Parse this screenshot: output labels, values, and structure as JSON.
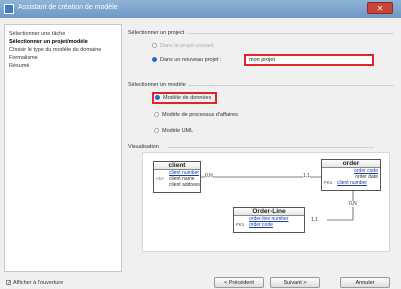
{
  "window": {
    "title": "Assistant de création de modèle"
  },
  "sidebar": {
    "items": [
      {
        "label": "Sélectionner une tâche"
      },
      {
        "label": "Sélectionner un projet/modèle"
      },
      {
        "label": "Choisir le type du modèle du domaine"
      },
      {
        "label": "Formalisme"
      },
      {
        "label": "Résumé"
      }
    ]
  },
  "project": {
    "section_label": "Sélectionner un project",
    "current_label": "Dans le projet courant",
    "new_label": "Dans un nouveau projet :",
    "new_value": "mon projet"
  },
  "model": {
    "section_label": "Sélectionner un modèle",
    "options": [
      {
        "label": "Modèle de données"
      },
      {
        "label": "Modèle de processus d'affaires"
      },
      {
        "label": "Modèle UML"
      }
    ]
  },
  "preview": {
    "label": "Visualisation",
    "client": {
      "name": "client",
      "rows": [
        {
          "key": "",
          "text": "client number"
        },
        {
          "key": "<1>",
          "text": "client name"
        },
        {
          "key": "",
          "text": "client address"
        }
      ]
    },
    "order": {
      "name": "order",
      "rows": [
        {
          "key": "",
          "text": "order code"
        },
        {
          "key": "",
          "text": "order date"
        },
        {
          "key": "FK1",
          "text": "client number"
        }
      ]
    },
    "orderline": {
      "name": "Order-Line",
      "rows": [
        {
          "key": "",
          "text": "order-line number"
        },
        {
          "key": "FK1",
          "text": "order code"
        }
      ]
    },
    "cardinalities": {
      "client_side": "0,N",
      "order_side": "1,1",
      "order_bottom": "0,N",
      "line_side": "1,1"
    }
  },
  "footer": {
    "show_label": "Afficher à l'ouverture",
    "prev_label": "< Précédent",
    "next_label": "Suivant >",
    "cancel_label": "Annuler"
  },
  "colors": {
    "highlight": "#e0242b",
    "accent": "#2a6bc0"
  }
}
